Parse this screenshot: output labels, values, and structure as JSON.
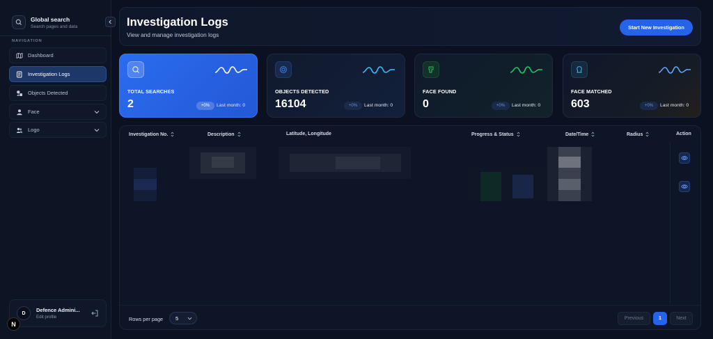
{
  "sidebar": {
    "search_title": "Global search",
    "search_subtitle": "Search pages and data",
    "nav_heading": "NAVIGATION",
    "items": [
      {
        "label": "Dashboard"
      },
      {
        "label": "Investigation Logs"
      },
      {
        "label": "Objects Detected"
      },
      {
        "label": "Face"
      },
      {
        "label": "Logo"
      }
    ],
    "profile": {
      "initial": "D",
      "name": "Defence Admini...",
      "edit": "Edit profile"
    },
    "dev_badge": "N"
  },
  "header": {
    "title": "Investigation Logs",
    "subtitle": "View and manage investigation logs",
    "cta": "Start New Investigation"
  },
  "stats": [
    {
      "label": "TOTAL SEARCHES",
      "value": "2",
      "change": "+0%",
      "last_month": "Last month: 0",
      "icon": "search-icon",
      "wave_color": "#ffffff"
    },
    {
      "label": "OBJECTS DETECTED",
      "value": "16104",
      "change": "+0%",
      "last_month": "Last month: 0",
      "icon": "target-icon",
      "wave_color": "#38bdf8"
    },
    {
      "label": "FACE FOUND",
      "value": "0",
      "change": "+0%",
      "last_month": "Last month: 0",
      "icon": "face-id-icon",
      "wave_color": "#22c55e"
    },
    {
      "label": "FACE MATCHED",
      "value": "603",
      "change": "+0%",
      "last_month": "Last month: 0",
      "icon": "face-match-icon",
      "wave_color": "#60a5fa"
    }
  ],
  "table": {
    "columns": [
      "Investigation No.",
      "Description",
      "Latitude, Longitude",
      "Progress & Status",
      "Date/Time",
      "Radius",
      "Action"
    ]
  },
  "pagination": {
    "rows_per_page_label": "Rows per page",
    "rows_per_page": "5",
    "previous": "Previous",
    "page": "1",
    "next": "Next"
  },
  "colors": {
    "accent": "#2563eb",
    "background": "#0b1120"
  }
}
